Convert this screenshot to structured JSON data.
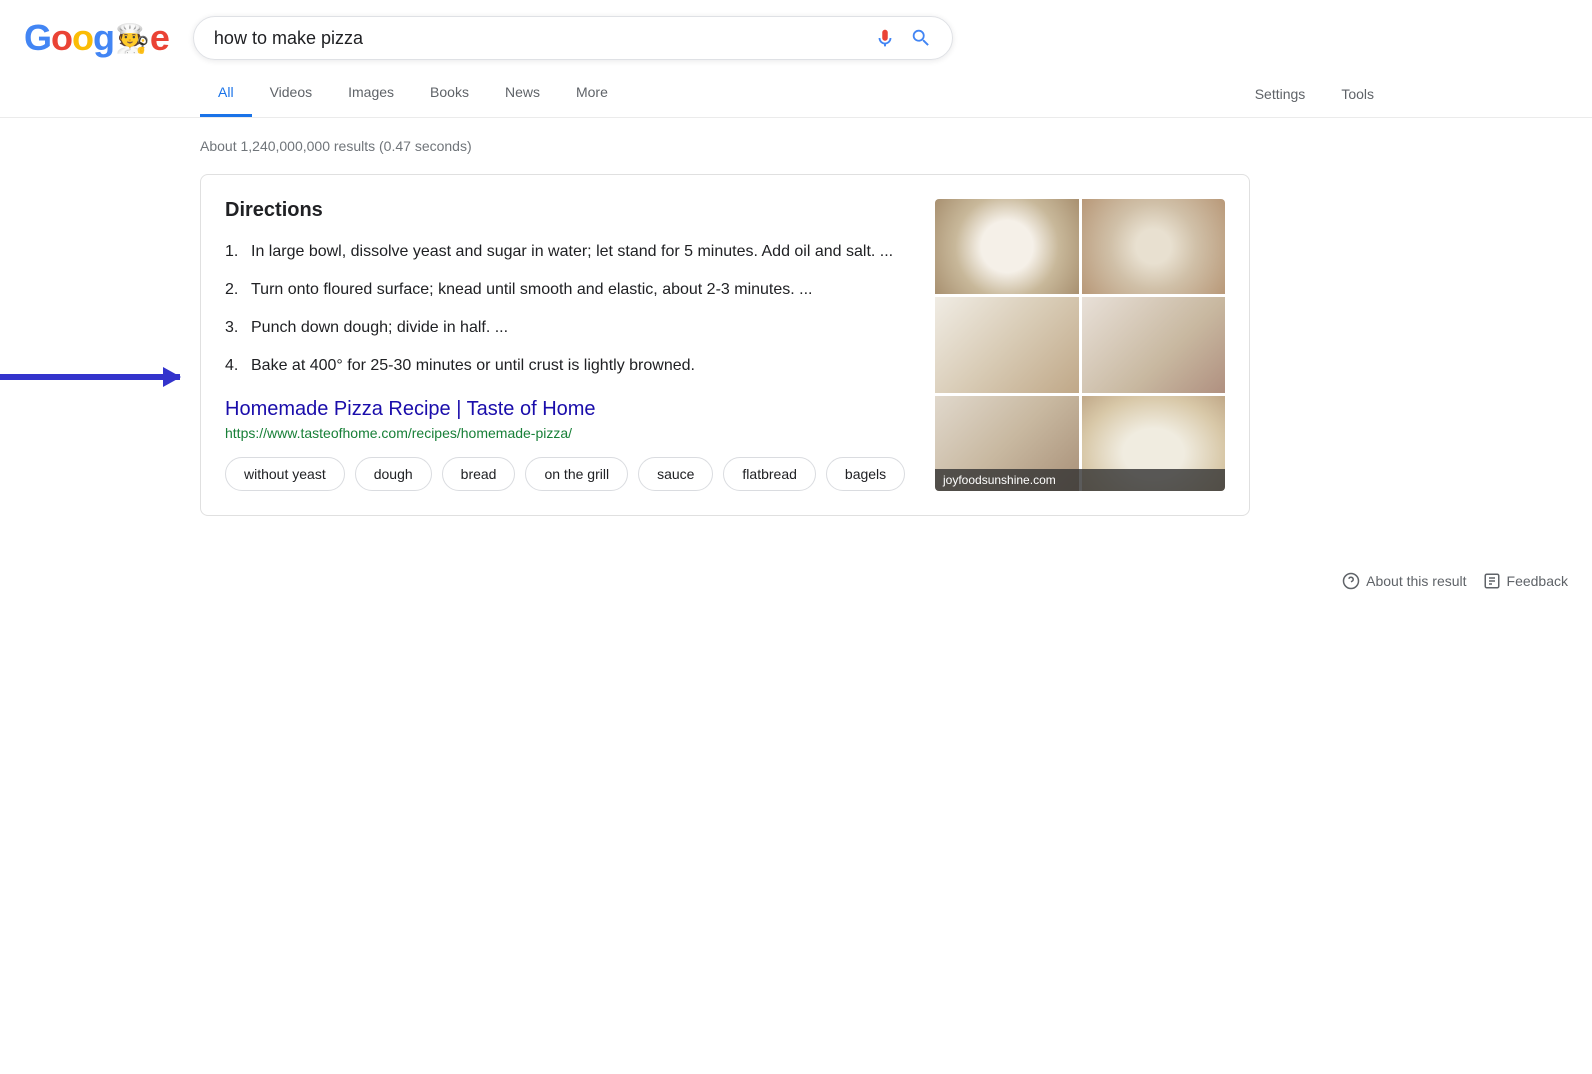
{
  "header": {
    "logo": {
      "letters": [
        "G",
        "o",
        "o",
        "g",
        "chef",
        "e"
      ]
    },
    "search_value": "how to make pizza",
    "search_placeholder": "Search"
  },
  "nav": {
    "tabs": [
      {
        "label": "All",
        "active": true
      },
      {
        "label": "Videos",
        "active": false
      },
      {
        "label": "Images",
        "active": false
      },
      {
        "label": "Books",
        "active": false
      },
      {
        "label": "News",
        "active": false
      },
      {
        "label": "More",
        "active": false
      }
    ],
    "right": [
      {
        "label": "Settings"
      },
      {
        "label": "Tools"
      }
    ]
  },
  "results": {
    "count_text": "About 1,240,000,000 results (0.47 seconds)"
  },
  "snippet": {
    "title": "Directions",
    "steps": [
      {
        "num": "1.",
        "text": "In large bowl, dissolve yeast and sugar in water; let stand for 5 minutes. Add oil and salt. ..."
      },
      {
        "num": "2.",
        "text": "Turn onto floured surface; knead until smooth and elastic, about 2-3 minutes. ..."
      },
      {
        "num": "3.",
        "text": "Punch down dough; divide in half. ..."
      },
      {
        "num": "4.",
        "text": "Bake at 400° for 25-30 minutes or until crust is lightly browned."
      }
    ],
    "image_source": "joyfoodsunshine.com",
    "link_title": "Homemade Pizza Recipe | Taste of Home",
    "link_url": "https://www.tasteofhome.com/recipes/homemade-pizza/",
    "related_chips": [
      "without yeast",
      "dough",
      "bread",
      "on the grill",
      "sauce",
      "flatbread",
      "bagels"
    ]
  },
  "footer": {
    "about_label": "About this result",
    "feedback_label": "Feedback"
  }
}
